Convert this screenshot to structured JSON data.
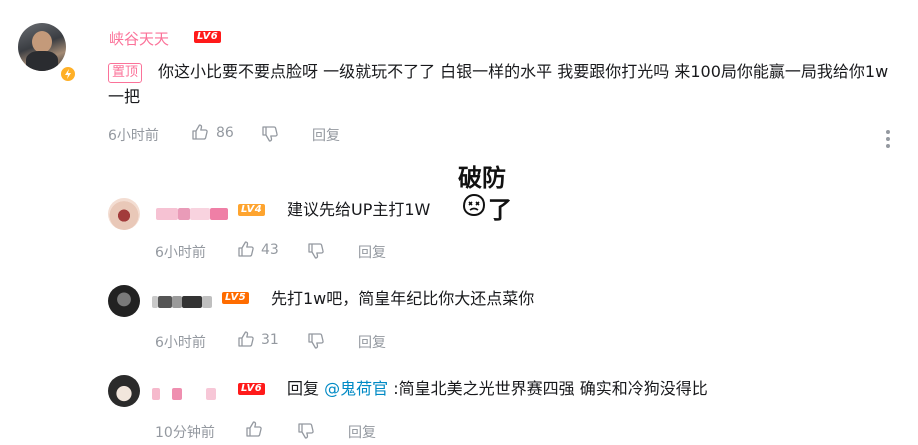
{
  "comment": {
    "username": "峡谷天天",
    "level_label": "LV6",
    "pinned_label": "置顶",
    "text": "你这小比要不要点脸呀 一级就玩不了了 白银一样的水平 我要跟你打光吗 来100局你能赢一局我给你1w一把",
    "time": "6小时前",
    "likes": "86",
    "reply_label": "回复"
  },
  "replies": [
    {
      "level_label": "LV4",
      "text": "建议先给UP主打1W",
      "sticker_text": "破防了",
      "sticker_top": "破防",
      "sticker_bottom": "了",
      "time": "6小时前",
      "likes": "43",
      "reply_label": "回复"
    },
    {
      "level_label": "LV5",
      "text": "先打1w吧，简皇年纪比你大还点菜你",
      "time": "6小时前",
      "likes": "31",
      "reply_label": "回复"
    },
    {
      "level_label": "LV6",
      "prefix": "回复",
      "mention": "@鬼荷官",
      "text": " :简皇北美之光世界赛四强 确实和冷狗没得比",
      "time": "10分钟前",
      "likes": "",
      "reply_label": "回复"
    }
  ],
  "colors": {
    "username_main": "#fb7299",
    "mention": "#008ac5",
    "lv6": "#ff1a1a",
    "lv4": "#fea42f",
    "lv5": "#ff6c00",
    "meta": "#9499a0"
  },
  "icons": {
    "like": "thumbs-up-icon",
    "dislike": "thumbs-down-icon",
    "more": "more-vertical-icon",
    "badge": "lightning-badge-icon"
  }
}
